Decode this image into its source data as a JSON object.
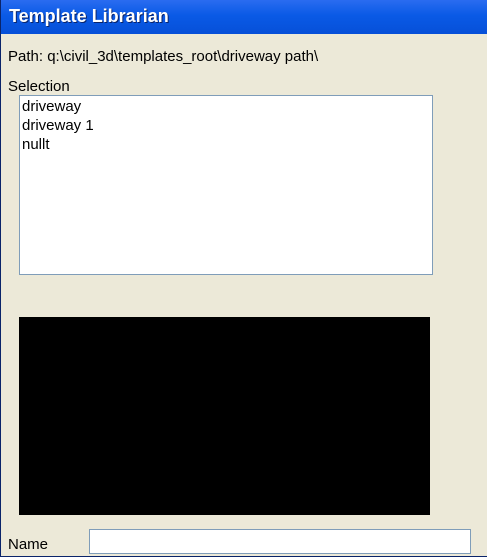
{
  "window": {
    "title": "Template Librarian"
  },
  "path": {
    "label": "Path: q:\\civil_3d\\templates_root\\driveway path\\"
  },
  "selection": {
    "label": "Selection",
    "items": [
      {
        "label": "driveway"
      },
      {
        "label": "driveway 1"
      },
      {
        "label": "nullt"
      }
    ]
  },
  "name_field": {
    "label": "Name",
    "value": ""
  },
  "colors": {
    "title_bar": "#0a5ae6",
    "dialog_background": "#ece9d8",
    "preview_background": "#000000"
  }
}
